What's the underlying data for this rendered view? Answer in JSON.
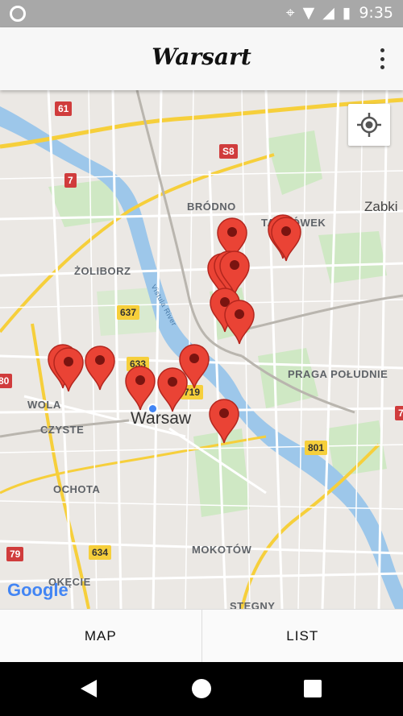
{
  "status_bar": {
    "time": "9:35"
  },
  "app_bar": {
    "title": "Warsart"
  },
  "map": {
    "city_label": "Warsaw",
    "district_labels": [
      "BRÓDNO",
      "TARGÓWEK",
      "Zabki",
      "ŻOLIBORZ",
      "WOLA",
      "CZYSTE",
      "PRAGA POŁUDNIE",
      "OCHOTA",
      "MOKOTÓW",
      "OKĘCIE",
      "STEGNY"
    ],
    "river_label": "Vistula River",
    "road_shields": {
      "red": [
        "61",
        "7",
        "S8",
        "79",
        "80",
        "7"
      ],
      "yellow": [
        "637",
        "634",
        "801",
        "633",
        "719"
      ]
    },
    "attribution": "Google",
    "marker_count": 15
  },
  "tabs": [
    {
      "label": "MAP"
    },
    {
      "label": "LIST"
    }
  ]
}
